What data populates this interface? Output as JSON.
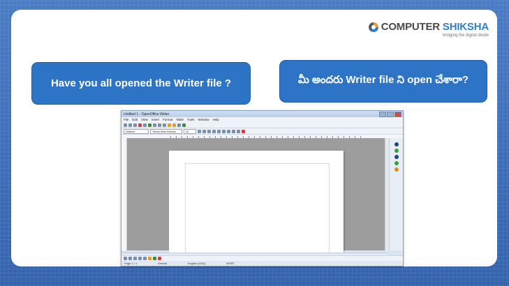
{
  "logo": {
    "word1": "COMPUTER",
    "word2": "SHIKSHA",
    "tagline": "bridging the digital divide"
  },
  "questions": {
    "english": "Have you all opened the Writer file ?",
    "telugu": "మీ అందరు Writer file ని open చేశారా?"
  },
  "writer_window": {
    "title": "Untitled 1 - OpenOffice Writer",
    "menu": [
      "File",
      "Edit",
      "View",
      "Insert",
      "Format",
      "Table",
      "Tools",
      "Window",
      "Help"
    ],
    "style_value": "Default",
    "font_value": "Times New Roman",
    "size_value": "12",
    "status": {
      "page": "Page 1 / 1",
      "style": "Default",
      "language": "English (USA)",
      "mode": "INSRT"
    }
  },
  "colors": {
    "bubble": "#2e74c6",
    "background": "#3f6fb8"
  }
}
